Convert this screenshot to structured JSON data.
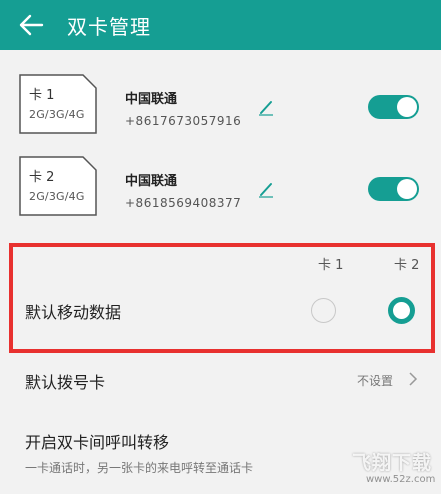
{
  "header": {
    "title": "双卡管理",
    "back_icon": "arrow-left-icon",
    "color": "#159e93"
  },
  "cards": [
    {
      "sim_name": "卡 1",
      "network": "2G/3G/4G",
      "carrier": "中国联通",
      "phone": "+8617673057916",
      "enabled": true
    },
    {
      "sim_name": "卡 2",
      "network": "2G/3G/4G",
      "carrier": "中国联通",
      "phone": "+8618569408377",
      "enabled": true
    }
  ],
  "default_data": {
    "label": "默认移动数据",
    "col1": "卡 1",
    "col2": "卡 2",
    "selected": "卡 2",
    "highlight_color": "#e8312f"
  },
  "default_dial": {
    "label": "默认拨号卡",
    "value": "不设置"
  },
  "call_forward": {
    "title": "开启双卡间呼叫转移",
    "description": "一卡通话时，另一张卡的来电呼转至通话卡"
  },
  "watermark": {
    "main": "飞翔下载",
    "sub": "www.52z.com"
  }
}
